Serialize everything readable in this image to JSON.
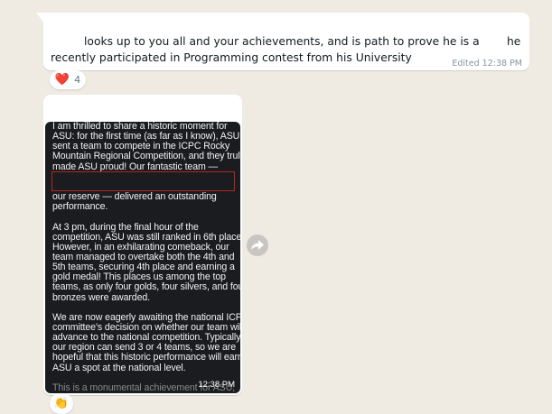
{
  "messages": [
    {
      "line1_part1": "looks up to you all and your achievements, and is path to prove he is a",
      "line1_part2": "he",
      "line2": "recently participated in Programming contest from his University",
      "meta": "Edited 12:38 PM",
      "reaction": {
        "emoji": "❤️",
        "count": "4"
      }
    },
    {
      "image_lines": [
        "I am thrilled to share a historic moment for",
        "ASU: for the first time (as far as I know), ASU",
        "sent a team to compete in the ICPC Rocky",
        "Mountain Regional Competition, and they truly",
        "made ASU proud! Our fantastic team —",
        "",
        "",
        "our reserve — delivered an outstanding",
        "performance.",
        "",
        "At 3 pm, during the final hour of the",
        "competition, ASU was still ranked in 6th place.",
        "However, in an exhilarating comeback, our",
        "team managed to overtake both the 4th and",
        "5th teams, securing 4th place and earning a",
        "gold medal! This places us among the top",
        "teams, as only four golds, four silvers, and four",
        "bronzes were awarded.",
        "",
        "We are now eagerly awaiting the national ICPC",
        "committee's decision on whether our team will",
        "advance to the national competition. Typically,",
        "our region can send 3 or 4 teams, so we are",
        "hopeful that this historic performance will earn",
        "ASU a spot at the national level.",
        "",
        "This is a monumental achievement for ASU,"
      ],
      "time": "12:38 PM",
      "reaction": {
        "emoji": "👏"
      }
    }
  ]
}
